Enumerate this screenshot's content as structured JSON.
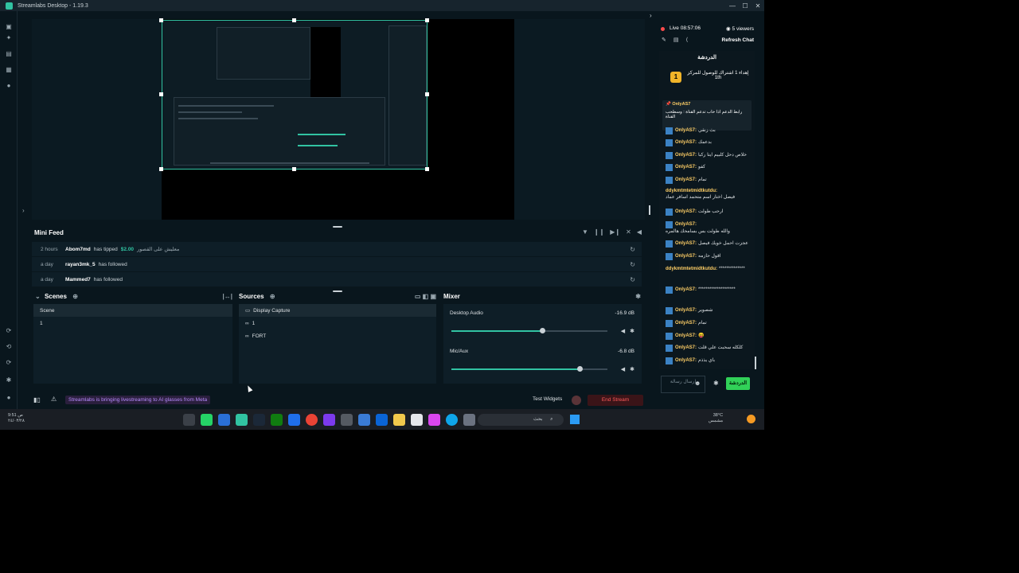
{
  "window": {
    "title": "Streamlabs Desktop - 1.19.3",
    "controls": [
      "—",
      "☐",
      "✕"
    ]
  },
  "minifeed": {
    "title": "Mini Feed",
    "items": [
      {
        "time": "2 hours",
        "user": "Abom7md",
        "action": "has tipped",
        "amount": "$2.00",
        "message": "معليش على القصور"
      },
      {
        "time": "a day",
        "user": "rayan3mk_5",
        "action": "has followed",
        "amount": "",
        "message": ""
      },
      {
        "time": "a day",
        "user": "Mammed7",
        "action": "has followed",
        "amount": "",
        "message": ""
      }
    ]
  },
  "scenes": {
    "title": "Scenes",
    "header": "Scene",
    "items": [
      "1"
    ]
  },
  "sources": {
    "title": "Sources",
    "items": [
      "Display Capture",
      "1",
      "FORT"
    ]
  },
  "mixer": {
    "title": "Mixer",
    "channels": [
      {
        "name": "Desktop Audio",
        "db": "-16.9 dB",
        "level": 0.58
      },
      {
        "name": "Mic/Aux",
        "db": "-6.8 dB",
        "level": 0.82
      }
    ]
  },
  "statusbar": {
    "banner": "Streamlabs is bringing livestreaming to AI glasses from Meta",
    "test_widgets": "Test Widgets",
    "end_stream": "End Stream"
  },
  "chat": {
    "live": "Live 08:57:06",
    "viewers": "5 viewers",
    "refresh": "Refresh Chat",
    "title": "الدردشة",
    "goal_badge": "1",
    "goal_text": "إهداء 1 اشتراك للوصول للمركز 1th",
    "pinned_user": "OnlyAS7",
    "pinned_text": "رابط الدعم اذا حاب تدعم القناة : وسطحب القناة",
    "messages": [
      {
        "user": "OnlyAS7:",
        "text": "بث زنقي"
      },
      {
        "user": "OnlyAS7:",
        "text": "بدعمك"
      },
      {
        "user": "OnlyAS7:",
        "text": "خلاص دحل كلبيم ايتا ركبا"
      },
      {
        "user": "OnlyAS7:",
        "text": "كفو"
      },
      {
        "user": "OnlyAS7:",
        "text": "تمام"
      },
      {
        "user": "ddykmtmtetmidtkutdu:",
        "text": "فيصل اختار اسم متحمد اسافر عماد"
      },
      {
        "user": "OnlyAS7:",
        "text": "ارحب طولت"
      },
      {
        "user": "OnlyAS7:",
        "text": "والله طولت بس بسامحك هالمره"
      },
      {
        "user": "OnlyAS7:",
        "text": "عجزت احمل خويك فيصل"
      },
      {
        "user": "OnlyAS7:",
        "text": "اقول حازمه"
      },
      {
        "user": "ddykmtmtetmidtkutdu:",
        "text": "**************"
      },
      {
        "user": "OnlyAS7:",
        "text": "********************"
      },
      {
        "user": "OnlyAS7:",
        "text": "شصوير"
      },
      {
        "user": "OnlyAS7:",
        "text": "تمام"
      },
      {
        "user": "OnlyAS7:",
        "text": "😝"
      },
      {
        "user": "OnlyAS7:",
        "text": "كلكله سحبت علي قلت"
      },
      {
        "user": "OnlyAS7:",
        "text": "باي يذذم"
      }
    ],
    "input_placeholder": "إرسال رسالة",
    "send": "الدردشة"
  },
  "taskbar": {
    "time": "9:51 ص",
    "date": "٢٤/٠٣/٢٨",
    "search_text": "بحث",
    "weather_temp": "38°C",
    "weather_desc": "مشمس"
  }
}
